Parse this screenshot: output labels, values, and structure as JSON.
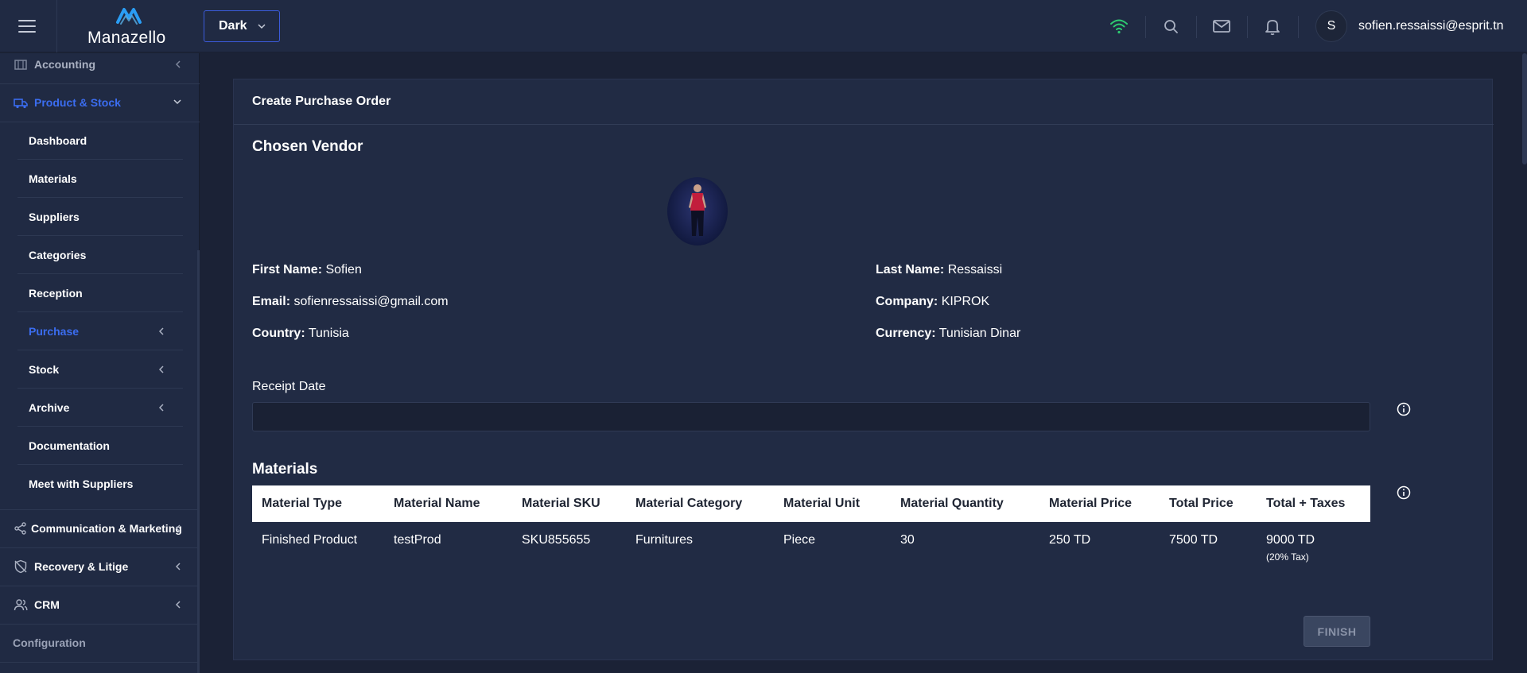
{
  "header": {
    "logo_text": "Manazello",
    "theme_value": "Dark",
    "avatar_initial": "S",
    "user_email": "sofien.ressaissi@esprit.tn",
    "wifi_color": "#2ecc71"
  },
  "sidebar": {
    "accounting_label": "Accounting",
    "product_stock_label": "Product & Stock",
    "sub_items": {
      "dashboard": "Dashboard",
      "materials": "Materials",
      "suppliers": "Suppliers",
      "categories": "Categories",
      "reception": "Reception",
      "purchase": "Purchase",
      "stock": "Stock",
      "archive": "Archive",
      "documentation": "Documentation",
      "meet_suppliers": "Meet with Suppliers"
    },
    "communication_label": "Communication & Marketing",
    "recovery_label": "Recovery & Litige",
    "crm_label": "CRM",
    "configuration_label": "Configuration",
    "active_color": "#3b6df0"
  },
  "card": {
    "title": "Create Purchase Order",
    "vendor_section_title": "Chosen Vendor",
    "vendor": {
      "first_name_label": "First Name:",
      "first_name": "Sofien",
      "last_name_label": "Last Name:",
      "last_name": "Ressaissi",
      "email_label": "Email:",
      "email": "sofienressaissi@gmail.com",
      "company_label": "Company:",
      "company": "KIPROK",
      "country_label": "Country:",
      "country": "Tunisia",
      "currency_label": "Currency:",
      "currency": "Tunisian Dinar"
    },
    "receipt_date_label": "Receipt Date",
    "receipt_date_value": "",
    "materials_section_title": "Materials",
    "table": {
      "headers": [
        "Material Type",
        "Material Name",
        "Material SKU",
        "Material Category",
        "Material Unit",
        "Material Quantity",
        "Material Price",
        "Total Price",
        "Total + Taxes"
      ],
      "rows": [
        [
          "Finished Product",
          "testProd",
          "SKU855655",
          "Furnitures",
          "Piece",
          "30",
          "250 TD",
          "7500 TD",
          "9000 TD"
        ]
      ],
      "tax_note": "(20% Tax)"
    },
    "finish_label": "FINISH"
  }
}
